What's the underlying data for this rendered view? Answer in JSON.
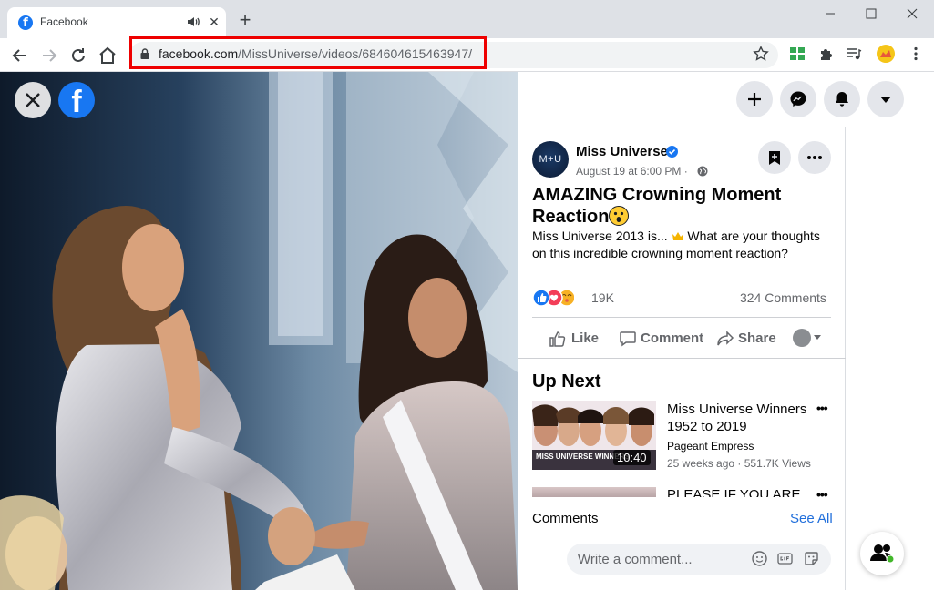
{
  "browser": {
    "tab_title": "Facebook",
    "tab_favicon": "f",
    "url_domain": "facebook.com",
    "url_path": "/MissUniverse/videos/684604615463947/",
    "icons": [
      "back-icon",
      "forward-icon",
      "reload-icon",
      "home-icon",
      "lock-icon",
      "bookmark-star-icon",
      "extension-icon",
      "puzzle-icon",
      "media-icon",
      "profile-icon",
      "menu-icon"
    ]
  },
  "video": {
    "close_icon": "close-icon",
    "logo": "f"
  },
  "header_actions": [
    "create-icon",
    "messenger-icon",
    "notifications-icon",
    "account-menu-icon"
  ],
  "post": {
    "avatar_text": "M+U",
    "page_name": "Miss Universe",
    "date": "August 19 at 6:00 PM · ",
    "title": "AMAZING Crowning Moment Reaction",
    "body_before": "Miss Universe 2013 is... ",
    "body_after": " What are your thoughts on this incredible crowning moment reaction?",
    "reaction_count": "19K",
    "comment_count": "324 Comments",
    "actions": {
      "like": "Like",
      "comment": "Comment",
      "share": "Share"
    }
  },
  "up_next": {
    "heading": "Up Next",
    "items": [
      {
        "title": "Miss Universe Winners 1952 to 2019",
        "channel": "Pageant Empress",
        "meta": "25 weeks ago · 551.7K Views",
        "duration": "10:40",
        "thumb_caption": "MISS UNIVERSE WINNERS"
      },
      {
        "title": "PLEASE IF YOU ARE"
      }
    ]
  },
  "comments": {
    "label": "Comments",
    "see_all": "See All",
    "placeholder": "Write a comment..."
  },
  "colors": {
    "facebook_blue": "#1877f2",
    "link_blue": "#216fdb",
    "highlight_red": "#ee0000",
    "grey_button": "#e4e6eb"
  }
}
